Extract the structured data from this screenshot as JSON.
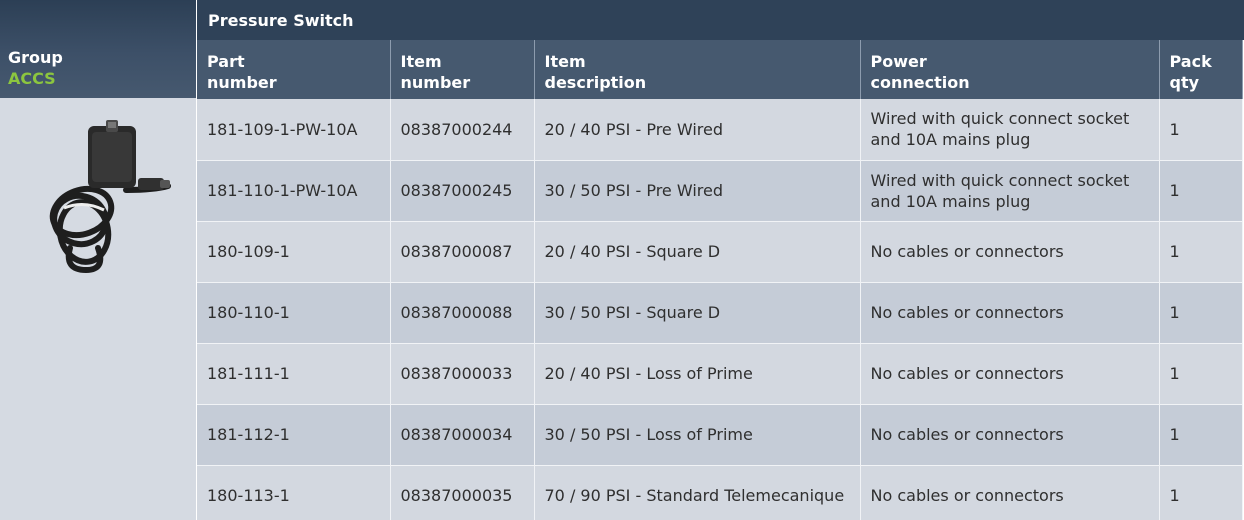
{
  "group": {
    "label": "Group",
    "value": "ACCS"
  },
  "product": {
    "image_icon": "pressure-switch-photo"
  },
  "section_title": "Pressure Switch",
  "columns": [
    [
      "Part",
      "number"
    ],
    [
      "Item",
      "number"
    ],
    [
      "Item",
      "description"
    ],
    [
      "Power",
      "connection"
    ],
    [
      "Pack",
      "qty"
    ]
  ],
  "rows": [
    {
      "part": "181-109-1-PW-10A",
      "item": "08387000244",
      "description": "20 / 40 PSI - Pre Wired",
      "power": "Wired with quick connect socket and 10A mains plug",
      "qty": "1"
    },
    {
      "part": "181-110-1-PW-10A",
      "item": "08387000245",
      "description": "30 / 50 PSI - Pre Wired",
      "power": "Wired with quick connect socket and 10A mains plug",
      "qty": "1"
    },
    {
      "part": "180-109-1",
      "item": "08387000087",
      "description": "20 / 40 PSI - Square D",
      "power": "No cables or connectors",
      "qty": "1"
    },
    {
      "part": "180-110-1",
      "item": "08387000088",
      "description": "30 / 50 PSI - Square D",
      "power": "No cables or connectors",
      "qty": "1"
    },
    {
      "part": "181-111-1",
      "item": "08387000033",
      "description": "20 / 40 PSI - Loss of Prime",
      "power": "No cables or connectors",
      "qty": "1"
    },
    {
      "part": "181-112-1",
      "item": "08387000034",
      "description": "30 / 50 PSI - Loss of Prime",
      "power": "No cables or connectors",
      "qty": "1"
    },
    {
      "part": "180-113-1",
      "item": "08387000035",
      "description": "70 / 90 PSI - Standard Telemecanique",
      "power": "No cables or connectors",
      "qty": "1"
    }
  ]
}
